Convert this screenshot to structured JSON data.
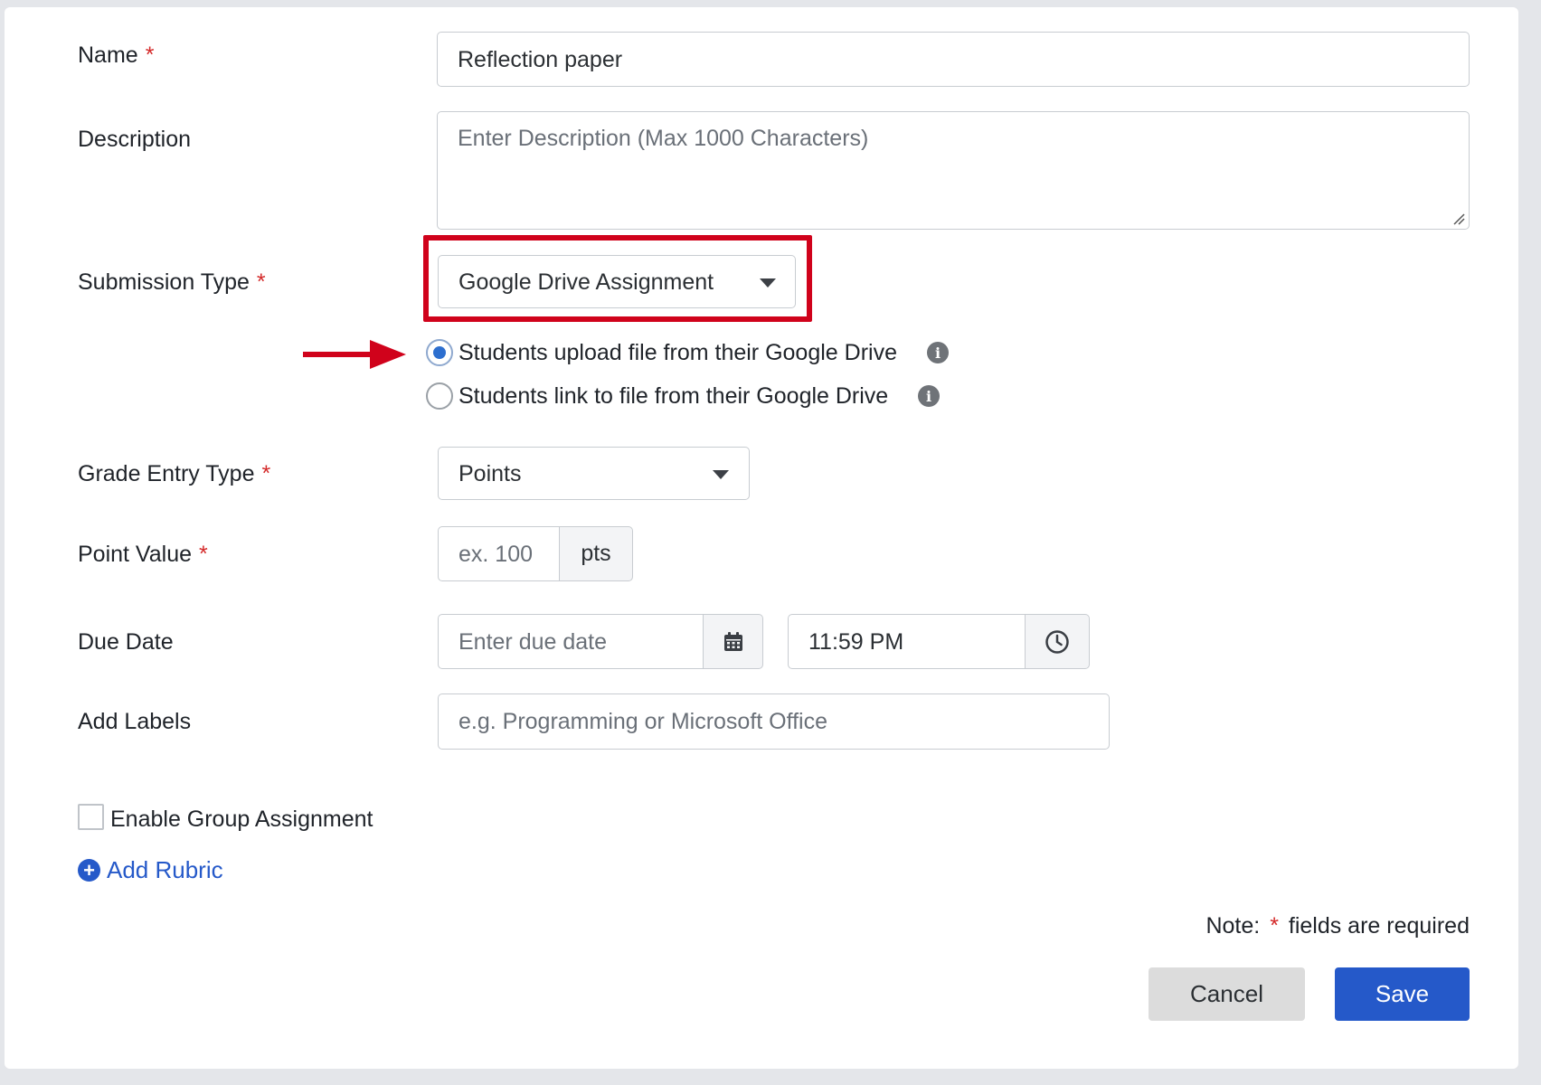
{
  "form": {
    "name": {
      "label": "Name",
      "value": "Reflection paper"
    },
    "description": {
      "label": "Description",
      "placeholder": "Enter Description (Max 1000 Characters)"
    },
    "submission_type": {
      "label": "Submission Type",
      "selected": "Google Drive Assignment",
      "options": [
        {
          "label": "Students upload file from their Google Drive",
          "checked": true
        },
        {
          "label": "Students link to file from their Google Drive",
          "checked": false
        }
      ]
    },
    "grade_entry_type": {
      "label": "Grade Entry Type",
      "selected": "Points"
    },
    "point_value": {
      "label": "Point Value",
      "placeholder": "ex. 100",
      "unit": "pts"
    },
    "due_date": {
      "label": "Due Date",
      "date_placeholder": "Enter due date",
      "time_value": "11:59 PM"
    },
    "labels": {
      "label": "Add Labels",
      "placeholder": "e.g. Programming or Microsoft Office"
    },
    "group_assignment": {
      "label": "Enable Group Assignment",
      "checked": false
    },
    "add_rubric": "Add Rubric",
    "required_marker": "*",
    "note": {
      "prefix": "Note:",
      "suffix": "fields are required"
    }
  },
  "buttons": {
    "cancel": "Cancel",
    "save": "Save"
  },
  "icons": {
    "info": "info-icon",
    "calendar": "calendar-icon",
    "clock": "clock-icon",
    "dropdown": "chevron-down-icon",
    "plus": "plus-circle-icon",
    "arrow": "arrow-right-icon"
  },
  "colors": {
    "accent": "#2559c9",
    "highlight": "#d0021b",
    "required": "#d42a2a"
  }
}
